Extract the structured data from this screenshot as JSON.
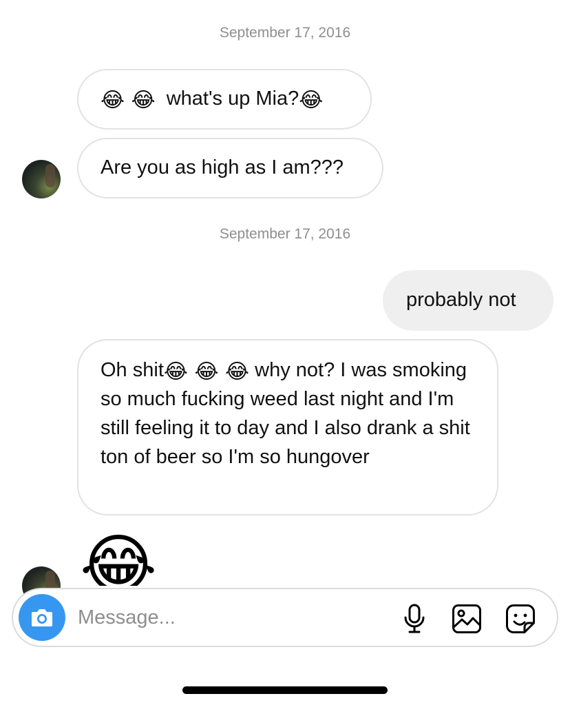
{
  "thread": {
    "date_1": "September 17, 2016",
    "date_2": "September 17, 2016",
    "messages": [
      {
        "direction": "incoming",
        "prefix_emoji": "😂 😂",
        "text": "what's up Mia?",
        "suffix_emoji": "😂"
      },
      {
        "direction": "incoming",
        "text": "Are you as high as I am???"
      },
      {
        "direction": "outgoing",
        "text": "probably not"
      },
      {
        "direction": "incoming",
        "text_start": "Oh shit",
        "inline_emoji": "😂 😂 😂",
        "text_rest": " why not? I was smoking so much fucking weed last night and I'm still feeling it to day and I also drank a shit ton of beer so I'm so hungover"
      },
      {
        "direction": "incoming",
        "emoji_only": "😂"
      }
    ]
  },
  "composer": {
    "placeholder": "Message...",
    "camera_icon": "camera-icon",
    "mic_icon": "microphone-icon",
    "gallery_icon": "gallery-icon",
    "sticker_icon": "sticker-icon"
  },
  "colors": {
    "camera_button": "#3797f0",
    "incoming_border": "#e2e2e2",
    "outgoing_bg": "#efefef",
    "date_text": "#8e8e8e"
  }
}
